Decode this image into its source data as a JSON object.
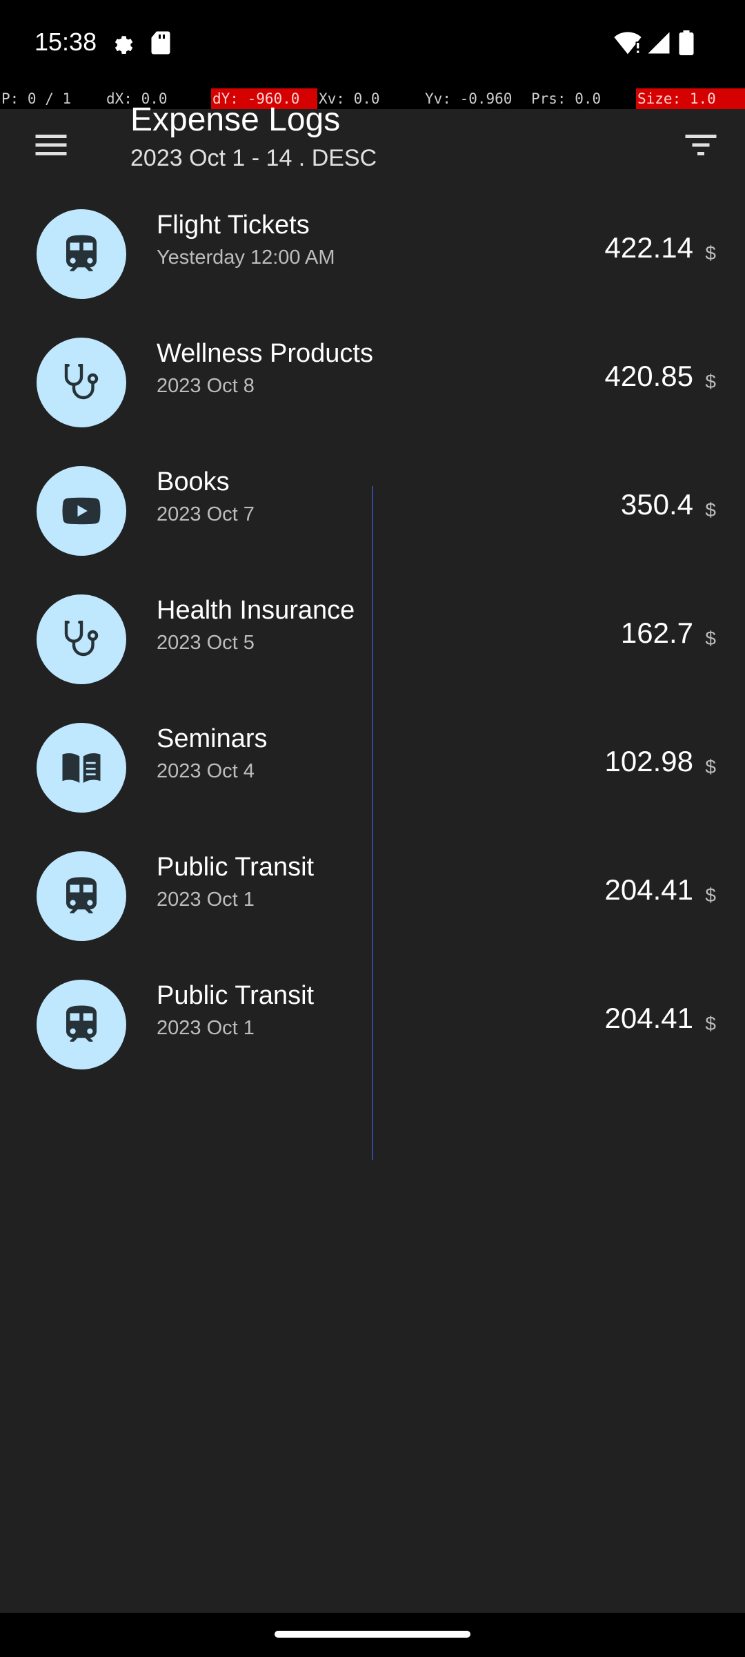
{
  "status_bar": {
    "time": "15:38",
    "icons": [
      "settings-icon",
      "sd-card-icon",
      "wifi-icon",
      "cell-signal-icon",
      "battery-icon"
    ]
  },
  "debug_bar": {
    "p": "P: 0 / 1",
    "dx": "dX: 0.0",
    "dy": "dY: -960.0",
    "xv": "Xv: 0.0",
    "yv": "Yv: -0.960",
    "prs": "Prs: 0.0",
    "size": "Size: 1.0"
  },
  "header": {
    "title": "Expense Logs",
    "subtitle": "2023 Oct 1 - 14 . DESC",
    "menu_icon": "hamburger-menu-icon",
    "filter_icon": "filter-icon"
  },
  "expenses": [
    {
      "title": "Flight Tickets",
      "date": "Yesterday 12:00 AM",
      "amount": "422.14",
      "currency": "$",
      "icon": "train-icon"
    },
    {
      "title": "Wellness Products",
      "date": "2023 Oct 8",
      "amount": "420.85",
      "currency": "$",
      "icon": "stethoscope-icon"
    },
    {
      "title": "Books",
      "date": "2023 Oct 7",
      "amount": "350.4",
      "currency": "$",
      "icon": "play-icon"
    },
    {
      "title": "Health Insurance",
      "date": "2023 Oct 5",
      "amount": "162.7",
      "currency": "$",
      "icon": "stethoscope-icon"
    },
    {
      "title": "Seminars",
      "date": "2023 Oct 4",
      "amount": "102.98",
      "currency": "$",
      "icon": "book-icon"
    },
    {
      "title": "Public Transit",
      "date": "2023 Oct 1",
      "amount": "204.41",
      "currency": "$",
      "icon": "train-icon"
    },
    {
      "title": "Public Transit",
      "date": "2023 Oct 1",
      "amount": "204.41",
      "currency": "$",
      "icon": "train-icon"
    }
  ],
  "colors": {
    "background": "#212121",
    "avatar": "#bfe8ff",
    "icon": "#263238"
  }
}
